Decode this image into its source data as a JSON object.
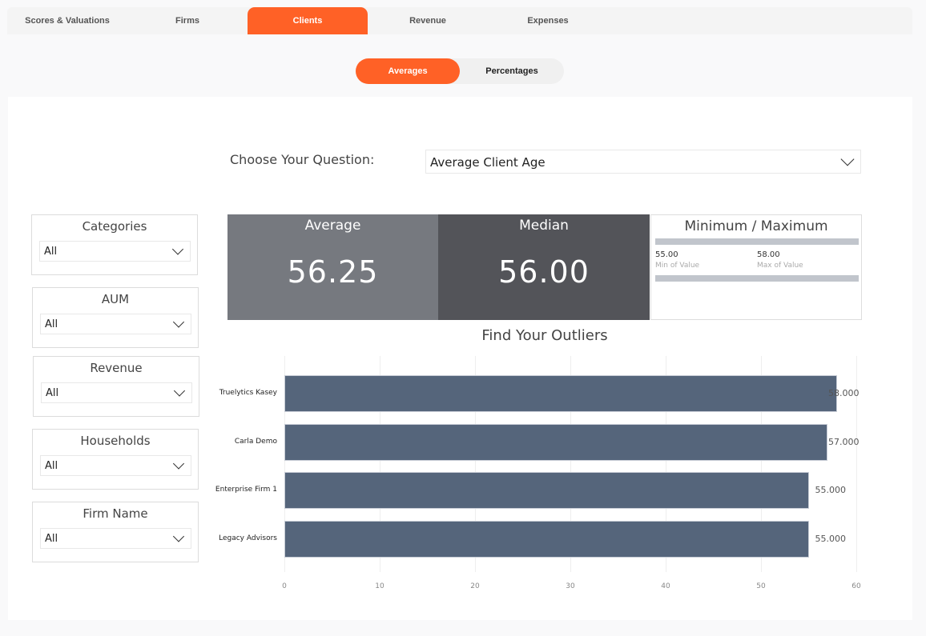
{
  "tabs": [
    {
      "label": "Scores & Valuations"
    },
    {
      "label": "Firms"
    },
    {
      "label": "Clients",
      "active": true
    },
    {
      "label": "Revenue"
    },
    {
      "label": "Expenses"
    }
  ],
  "toggle": {
    "options": [
      "Averages",
      "Percentages"
    ],
    "selected": "Averages"
  },
  "question": {
    "label": "Choose Your Question:",
    "value": "Average Client Age"
  },
  "slicers": [
    {
      "title": "Categories",
      "value": "All"
    },
    {
      "title": "AUM",
      "value": "All"
    },
    {
      "title": "Revenue",
      "value": "All"
    },
    {
      "title": "Households",
      "value": "All"
    },
    {
      "title": "Firm Name",
      "value": "All"
    }
  ],
  "kpis": {
    "average": {
      "title": "Average",
      "value": "56.25"
    },
    "median": {
      "title": "Median",
      "value": "56.00"
    }
  },
  "minmax": {
    "title": "Minimum / Maximum",
    "min": "55.00",
    "min_label": "Min of Value",
    "max": "58.00",
    "max_label": "Max of Value"
  },
  "colors": {
    "accent": "#ff6126",
    "bar": "#55657b",
    "average_card": "#76797f",
    "median_card": "#535459"
  },
  "chart_data": {
    "type": "bar",
    "orientation": "horizontal",
    "title": "Find Your Outliers",
    "categories": [
      "Truelytics Kasey",
      "Carla Demo",
      "Enterprise Firm 1",
      "Legacy Advisors"
    ],
    "values": [
      58,
      57,
      55,
      55
    ],
    "data_labels": [
      "58.000",
      "57.000",
      "55.000",
      "55.000"
    ],
    "xlim": [
      0,
      60
    ],
    "ticks": [
      "0",
      "10",
      "20",
      "30",
      "40",
      "50",
      "60"
    ],
    "grid": true
  }
}
